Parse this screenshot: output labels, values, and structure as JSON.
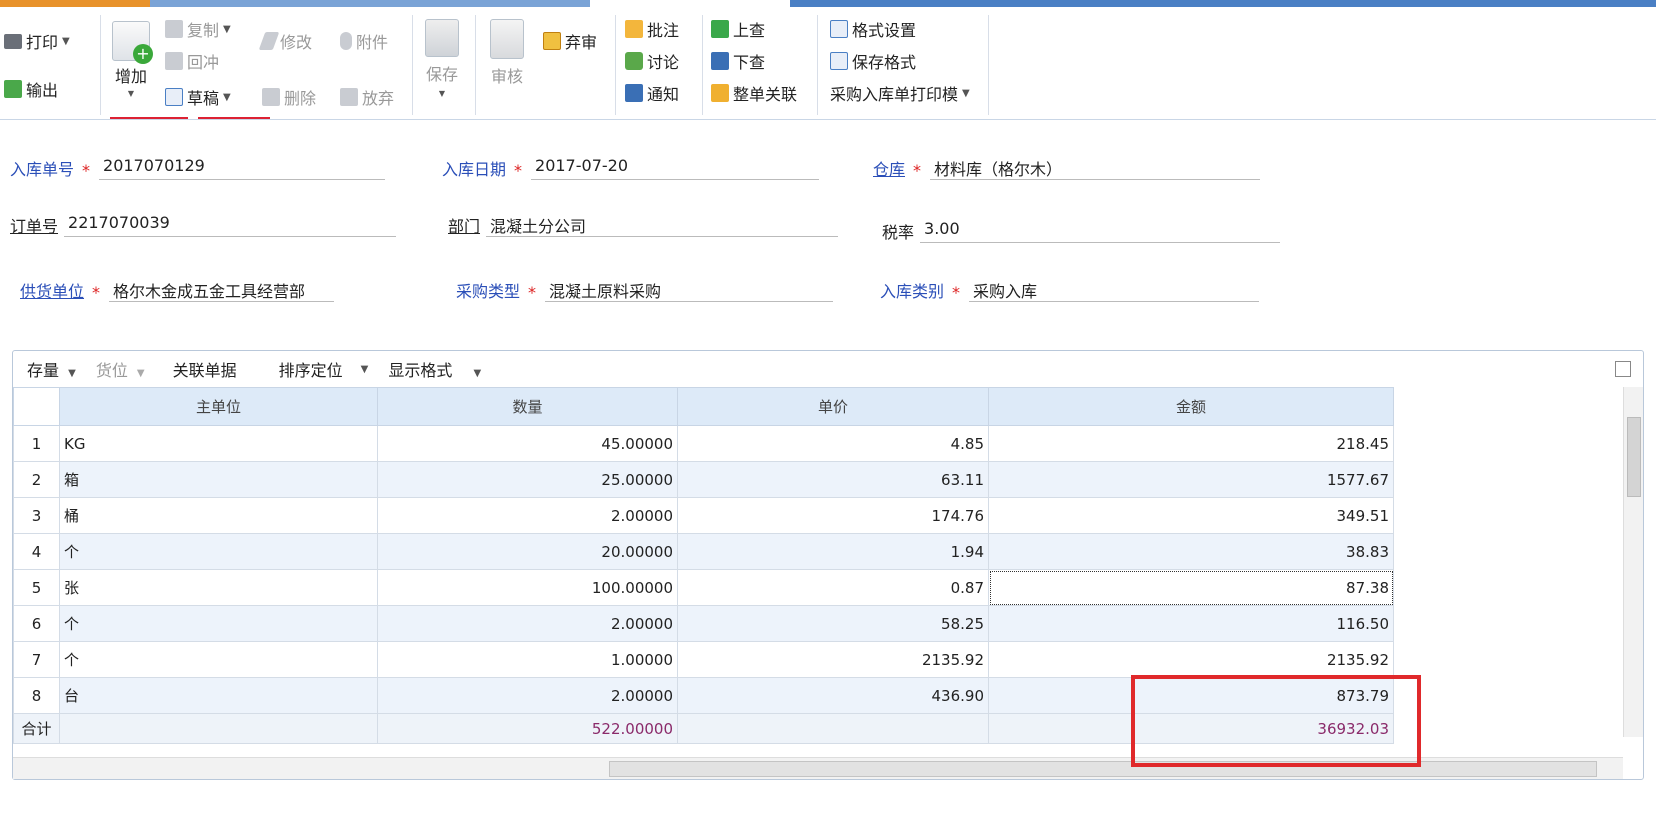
{
  "toolbar": {
    "print": "打印",
    "export": "输出",
    "add": "增加",
    "copy": "复制",
    "offset": "回冲",
    "draft": "草稿",
    "modify": "修改",
    "delete": "删除",
    "attach": "附件",
    "abandon": "放弃",
    "save": "保存",
    "audit": "审核",
    "reject_audit": "弃审",
    "annotate": "批注",
    "discuss": "讨论",
    "notify": "通知",
    "lookup_up": "上查",
    "lookup_down": "下查",
    "whole_link": "整单关联",
    "format_settings": "格式设置",
    "save_format": "保存格式",
    "print_template": "采购入库单打印模"
  },
  "form": {
    "receipt_no_label": "入库单号",
    "receipt_no": "2017070129",
    "receipt_date_label": "入库日期",
    "receipt_date": "2017-07-20",
    "warehouse_label": "仓库",
    "warehouse": "材料库（格尔木）",
    "order_no_label": "订单号",
    "order_no": "2217070039",
    "department_label": "部门",
    "department": "混凝土分公司",
    "tax_rate_label": "税率",
    "tax_rate": "3.00",
    "supplier_label": "供货单位",
    "supplier": "格尔木金成五金工具经营部",
    "purchase_type_label": "采购类型",
    "purchase_type": "混凝土原料采购",
    "receipt_type_label": "入库类别",
    "receipt_type": "采购入库"
  },
  "grid_toolbar": {
    "stock": "存量",
    "location": "货位",
    "related_docs": "关联单据",
    "sort_locate": "排序定位",
    "display_format": "显示格式"
  },
  "grid": {
    "headers": [
      "主单位",
      "数量",
      "单价",
      "金额"
    ],
    "rows": [
      {
        "no": "1",
        "unit": "KG",
        "qty": "45.00000",
        "price": "4.85",
        "amount": "218.45"
      },
      {
        "no": "2",
        "unit": "箱",
        "qty": "25.00000",
        "price": "63.11",
        "amount": "1577.67"
      },
      {
        "no": "3",
        "unit": "桶",
        "qty": "2.00000",
        "price": "174.76",
        "amount": "349.51"
      },
      {
        "no": "4",
        "unit": "个",
        "qty": "20.00000",
        "price": "1.94",
        "amount": "38.83"
      },
      {
        "no": "5",
        "unit": "张",
        "qty": "100.00000",
        "price": "0.87",
        "amount": "87.38"
      },
      {
        "no": "6",
        "unit": "个",
        "qty": "2.00000",
        "price": "58.25",
        "amount": "116.50"
      },
      {
        "no": "7",
        "unit": "个",
        "qty": "1.00000",
        "price": "2135.92",
        "amount": "2135.92"
      },
      {
        "no": "8",
        "unit": "台",
        "qty": "2.00000",
        "price": "436.90",
        "amount": "873.79"
      }
    ],
    "total_label": "合计",
    "total_qty": "522.00000",
    "total_amount": "36932.03"
  },
  "colors": {
    "accent": "#2b4fb8",
    "required": "#dd2222",
    "highlight_box": "#e0292b",
    "header_bg": "#ddeaf8"
  }
}
